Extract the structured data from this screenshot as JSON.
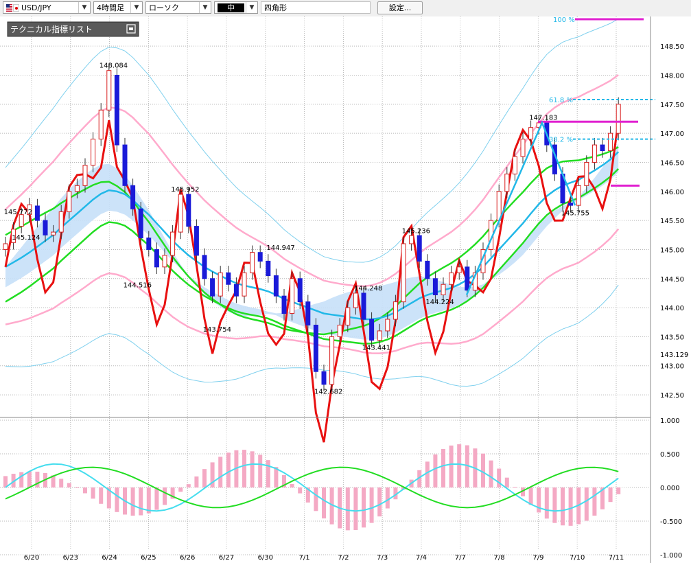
{
  "toolbar": {
    "pair": "USD/JPY",
    "timeframe": "4時間足",
    "chart_type": "ローソク",
    "line_width": "中",
    "shape": "四角形",
    "settings": "設定..."
  },
  "panel": {
    "title": "テクニカル指標リスト"
  },
  "colors": {
    "bull": "#d81e1e",
    "bear": "#1a1ad8",
    "bollinger": "#ffaacc",
    "bollinger_outer": "#7fd0ee",
    "ma_green": "#22dd22",
    "ma_blue": "#22b8e8",
    "rsi": "#e81010",
    "cloud": "#c6e0f8",
    "cloud2": "#fbc2df",
    "fib": "#e020d0"
  },
  "icons": [
    "us-flag-icon",
    "jp-flag-icon",
    "chevron-down-icon",
    "panel-collapse-icon"
  ],
  "chart_data": {
    "type": "candlestick",
    "price_axis": {
      "ylim": [
        142.3,
        148.75
      ],
      "ticks": [
        "148.50",
        "148.00",
        "147.50",
        "147.00",
        "146.50",
        "146.00",
        "145.50",
        "145.00",
        "144.50",
        "144.00",
        "143.50",
        "143.00",
        "142.50"
      ],
      "current_marker": "143.129"
    },
    "osc_axis": {
      "ylim": [
        -1.0,
        1.0
      ],
      "ticks": [
        "1.000",
        "0.500",
        "0.000",
        "-0.500",
        "-1.000"
      ]
    },
    "x_labels": [
      "6/20",
      "6/23",
      "6/24",
      "6/25",
      "6/26",
      "6/27",
      "6/30",
      "7/1",
      "7/2",
      "7/3",
      "7/4",
      "7/7",
      "7/8",
      "7/9",
      "7/10",
      "7/11"
    ],
    "annotations": [
      "148.084",
      "145.772",
      "145.124",
      "144.516",
      "145.952",
      "143.754",
      "144.947",
      "142.682",
      "144.248",
      "143.441",
      "145.236",
      "144.224",
      "147.183",
      "145.755"
    ],
    "fib_levels": [
      "100 %",
      "61.8 %",
      "38.2 %"
    ],
    "close": [
      145.1,
      145.35,
      145.6,
      145.77,
      145.5,
      145.25,
      145.3,
      145.65,
      146.0,
      146.1,
      146.45,
      146.9,
      147.4,
      148.08,
      146.8,
      146.1,
      145.7,
      145.2,
      145.0,
      144.7,
      144.9,
      145.3,
      145.95,
      145.4,
      144.9,
      144.5,
      144.2,
      144.6,
      144.4,
      144.2,
      144.6,
      144.95,
      144.8,
      144.55,
      144.2,
      143.9,
      144.5,
      144.1,
      143.7,
      142.9,
      142.68,
      143.5,
      143.7,
      144.0,
      144.25,
      143.8,
      143.44,
      143.6,
      143.8,
      144.1,
      145.1,
      145.24,
      144.8,
      144.5,
      144.22,
      144.4,
      144.6,
      144.7,
      144.3,
      144.6,
      145.0,
      145.5,
      146.0,
      146.3,
      146.6,
      146.9,
      147.1,
      147.18,
      146.8,
      146.3,
      145.8,
      145.76,
      146.1,
      146.5,
      146.8,
      146.7,
      147.0,
      147.5
    ],
    "open": [
      145.0,
      145.12,
      145.4,
      145.6,
      145.75,
      145.5,
      145.25,
      145.3,
      145.65,
      146.0,
      146.1,
      146.45,
      146.9,
      147.4,
      148.0,
      146.8,
      146.1,
      145.7,
      145.2,
      145.0,
      144.7,
      144.9,
      145.3,
      145.95,
      145.4,
      144.9,
      144.5,
      144.2,
      144.6,
      144.4,
      144.2,
      144.6,
      144.95,
      144.8,
      144.55,
      144.2,
      143.9,
      144.5,
      144.1,
      143.7,
      142.9,
      142.68,
      143.5,
      143.7,
      144.0,
      144.25,
      143.8,
      143.44,
      143.6,
      143.8,
      144.1,
      145.1,
      145.24,
      144.8,
      144.5,
      144.22,
      144.4,
      144.6,
      144.7,
      144.3,
      144.6,
      145.0,
      145.5,
      146.0,
      146.3,
      146.6,
      146.9,
      147.1,
      147.18,
      146.8,
      146.3,
      145.8,
      145.76,
      146.1,
      146.5,
      146.8,
      146.7,
      147.0
    ],
    "ma_blue": [
      144.7,
      144.78,
      144.86,
      144.95,
      145.05,
      145.15,
      145.25,
      145.38,
      145.5,
      145.62,
      145.74,
      145.86,
      145.96,
      146.02,
      146.0,
      145.95,
      145.85,
      145.72,
      145.6,
      145.45,
      145.3,
      145.15,
      145.02,
      144.9,
      144.8,
      144.7,
      144.62,
      144.55,
      144.48,
      144.42,
      144.38,
      144.35,
      144.32,
      144.28,
      144.22,
      144.15,
      144.1,
      144.05,
      144.0,
      143.95,
      143.9,
      143.88,
      143.86,
      143.84,
      143.82,
      143.8,
      143.8,
      143.82,
      143.86,
      143.92,
      144.0,
      144.08,
      144.16,
      144.22,
      144.26,
      144.3,
      144.34,
      144.4,
      144.48,
      144.58,
      144.7,
      144.85,
      145.0,
      145.15,
      145.3,
      145.45,
      145.62,
      145.78,
      145.92,
      146.02,
      146.1,
      146.15,
      146.2,
      146.28,
      146.36,
      146.45,
      146.55,
      146.68
    ]
  }
}
